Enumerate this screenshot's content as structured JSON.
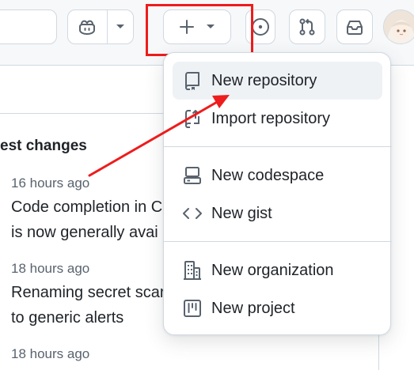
{
  "header": {
    "icons": [
      "copilot-icon",
      "chevron-down-icon",
      "plus-icon",
      "issue-open-icon",
      "git-pull-request-icon",
      "inbox-icon",
      "avatar"
    ]
  },
  "changelog": {
    "heading": "est changes",
    "entries": [
      {
        "time": "16 hours ago",
        "title_lines": [
          "Code completion in C",
          "is now generally avai"
        ]
      },
      {
        "time": "18 hours ago",
        "title_lines": [
          "Renaming secret scar",
          "to generic alerts"
        ]
      },
      {
        "time": "18 hours ago",
        "title_lines": []
      }
    ]
  },
  "create_menu": {
    "items": [
      {
        "label": "New repository",
        "icon": "repo-icon",
        "active": true
      },
      {
        "label": "Import repository",
        "icon": "repo-push-icon"
      },
      {
        "label": "New codespace",
        "icon": "codespaces-icon"
      },
      {
        "label": "New gist",
        "icon": "code-icon"
      },
      {
        "label": "New organization",
        "icon": "organization-icon"
      },
      {
        "label": "New project",
        "icon": "project-icon"
      }
    ]
  },
  "colors": {
    "annotation_red": "#ee1c1c",
    "header_bg": "#f6f8fa",
    "border": "#d1d9e0",
    "hover_bg": "#eff2f5",
    "muted_text": "#59636e"
  }
}
